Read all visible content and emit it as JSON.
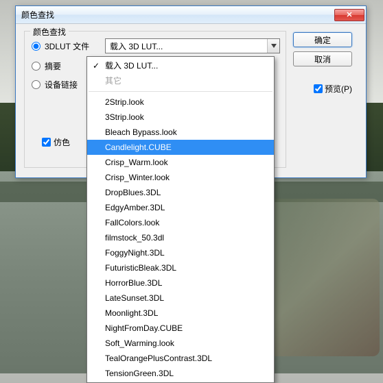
{
  "dialog": {
    "title": "颜色查找",
    "close_symbol": "✕",
    "legend": "颜色查找",
    "options": {
      "lut_label": "3DLUT 文件",
      "abstract_label": "摘要",
      "device_label": "设备链接"
    },
    "combo": {
      "value": "载入 3D LUT..."
    },
    "dither_label": "仿色",
    "ok_label": "确定",
    "cancel_label": "取消",
    "preview_label": "预览(P)"
  },
  "dropdown": {
    "current": "载入 3D LUT...",
    "other_label": "其它",
    "items": [
      "2Strip.look",
      "3Strip.look",
      "Bleach Bypass.look",
      "Candlelight.CUBE",
      "Crisp_Warm.look",
      "Crisp_Winter.look",
      "DropBlues.3DL",
      "EdgyAmber.3DL",
      "FallColors.look",
      "filmstock_50.3dl",
      "FoggyNight.3DL",
      "FuturisticBleak.3DL",
      "HorrorBlue.3DL",
      "LateSunset.3DL",
      "Moonlight.3DL",
      "NightFromDay.CUBE",
      "Soft_Warming.look",
      "TealOrangePlusContrast.3DL",
      "TensionGreen.3DL"
    ],
    "selected_index": 3
  }
}
